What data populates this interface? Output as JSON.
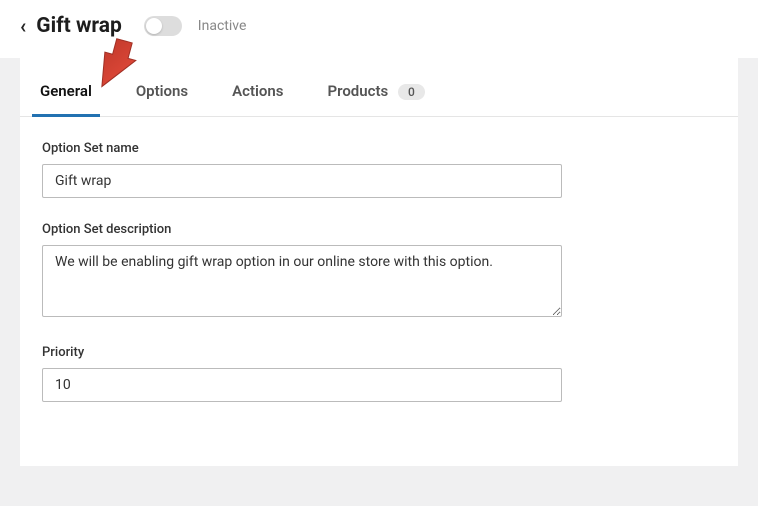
{
  "header": {
    "title": "Gift wrap",
    "toggle_state": "Inactive"
  },
  "tabs": {
    "general": "General",
    "options": "Options",
    "actions": "Actions",
    "products": "Products",
    "products_count": "0"
  },
  "form": {
    "name_label": "Option Set name",
    "name_value": "Gift wrap",
    "description_label": "Option Set description",
    "description_value": "We will be enabling gift wrap option in our online store with this option.",
    "priority_label": "Priority",
    "priority_value": "10"
  }
}
